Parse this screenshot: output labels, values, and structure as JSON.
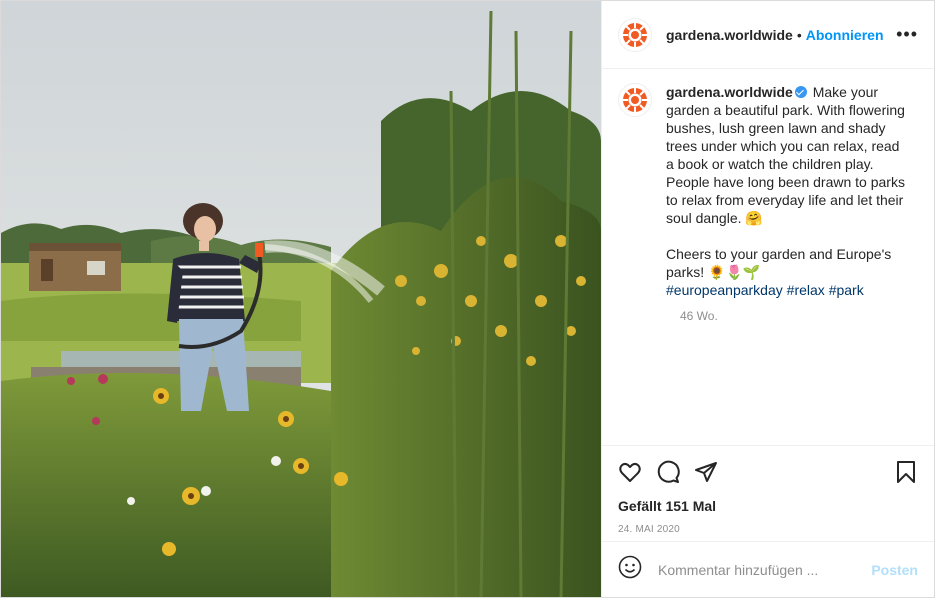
{
  "post": {
    "username": "gardena.worldwide",
    "separator": "•",
    "follow_label": "Abonnieren",
    "more_label": "•••",
    "caption": {
      "username": "gardena.worldwide",
      "text_part1": " Make your garden a beautiful park. With flowering bushes, lush green lawn and shady trees under which you can relax, read a book or watch the children play. People have long been drawn to parks to relax from everyday life and let their soul dangle. 🤗",
      "text_part2": "Cheers to your garden and Europe's parks! 🌻🌷🌱",
      "hashtags": [
        "#europeanparkday",
        "#relax",
        "#park"
      ]
    },
    "time_ago": "46 Wo.",
    "likes": "Gefällt 151 Mal",
    "date": "24. MAI 2020",
    "comment_placeholder": "Kommentar hinzufügen ...",
    "post_label": "Posten",
    "colors": {
      "accent": "#0095f6",
      "brand_orange": "#f15a22",
      "hashtag": "#00376b"
    },
    "icons": [
      "heart-icon",
      "comment-icon",
      "share-icon",
      "bookmark-icon",
      "emoji-icon",
      "verified-badge-icon",
      "gardena-logo"
    ]
  }
}
